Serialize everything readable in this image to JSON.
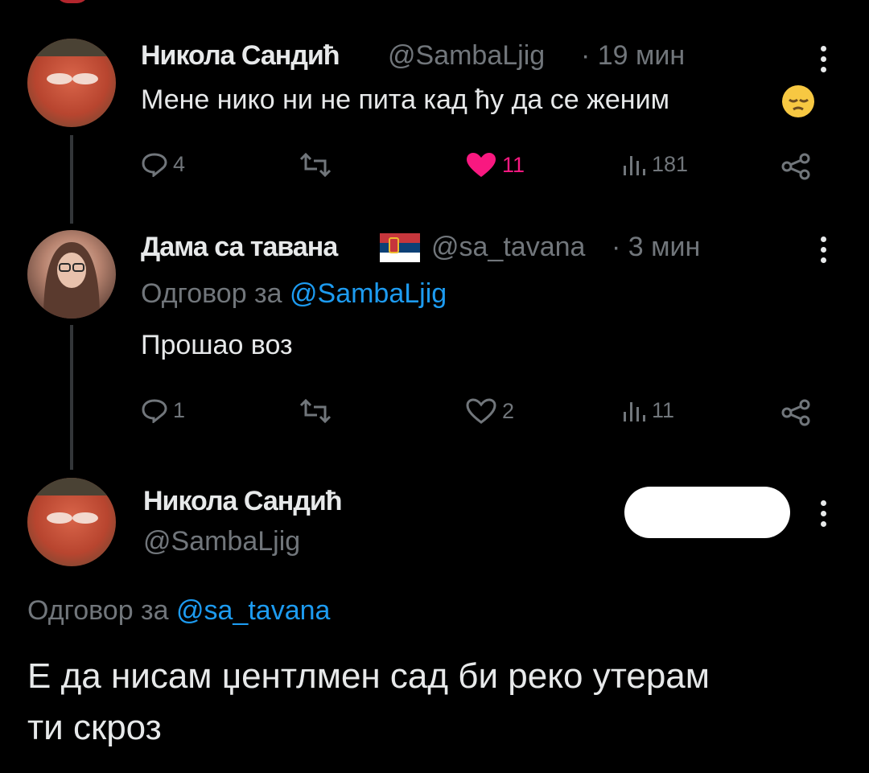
{
  "colors": {
    "background": "#000000",
    "text": "#e7e9ea",
    "muted": "#71767b",
    "link": "#1d9bf0",
    "like": "#f91880"
  },
  "tweet1": {
    "author_name": "Никола Сандић",
    "handle": "@SambaLjig",
    "time": "· 19 мин",
    "text": "Мене нико ни не пита кад ћу да се женим",
    "emoji": "pensive-face-icon",
    "replies": "4",
    "likes": "11",
    "views": "181",
    "liked": true
  },
  "tweet2": {
    "author_name": "Дама са тавана",
    "flag": "serbia-flag-icon",
    "handle": "@sa_tavana",
    "time": "· 3 мин",
    "reply_prefix": "Одговор за",
    "reply_to": "@SambaLjig",
    "text": "Прошао воз",
    "replies": "1",
    "likes": "2",
    "views": "11"
  },
  "tweet3": {
    "author_name": "Никола Сандић",
    "handle": "@SambaLjig",
    "reply_prefix": "Одговор за",
    "reply_to": "@sa_tavana",
    "text_line1": "Е да нисам џентлмен сад би реко утерам",
    "text_line2": "ти скроз"
  }
}
